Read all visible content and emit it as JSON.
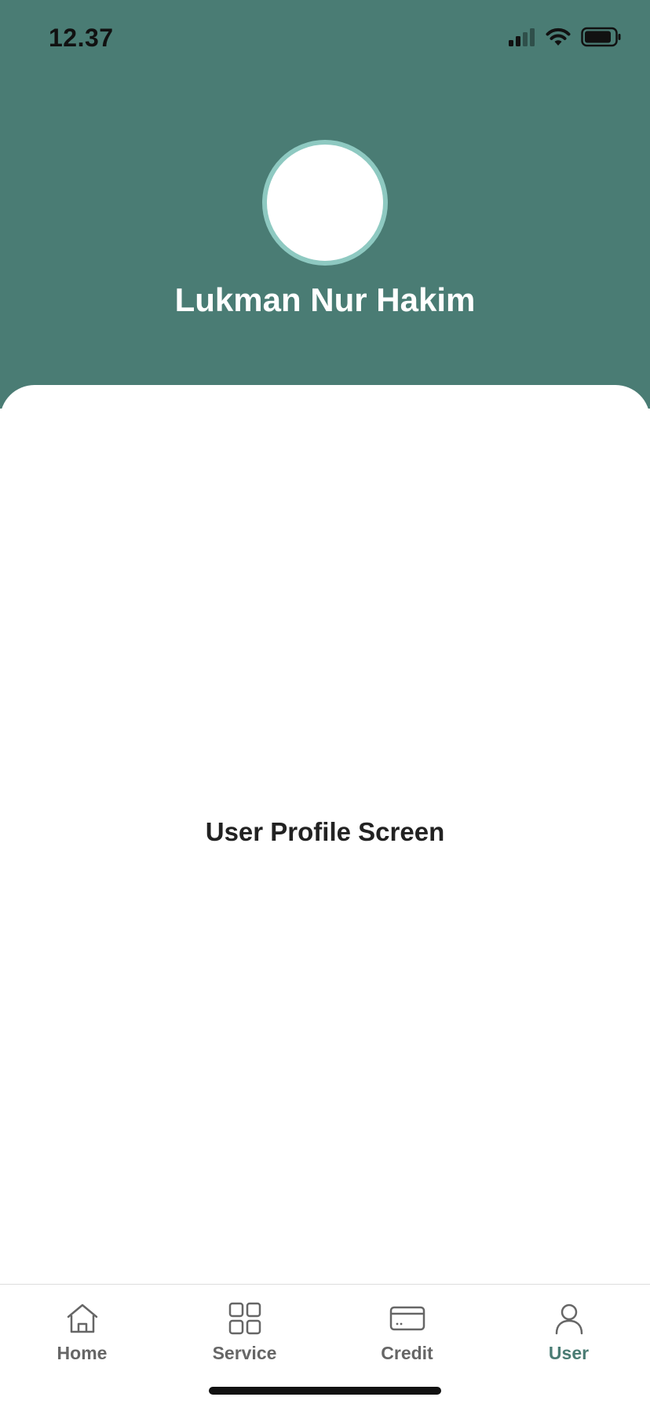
{
  "status_bar": {
    "time": "12.37",
    "signal_icon": "cellular-signal-icon",
    "wifi_icon": "wifi-icon",
    "battery_icon": "battery-icon"
  },
  "header": {
    "user_name": "Lukman Nur Hakim",
    "background_color": "#4a7c74",
    "avatar_border_color": "#8ec9c1"
  },
  "main": {
    "screen_label": "User Profile Screen"
  },
  "tab_bar": {
    "active_color": "#4a7c74",
    "inactive_color": "#666666",
    "tabs": [
      {
        "label": "Home",
        "icon": "home-icon",
        "active": false
      },
      {
        "label": "Service",
        "icon": "grid-icon",
        "active": false
      },
      {
        "label": "Credit",
        "icon": "credit-card-icon",
        "active": false
      },
      {
        "label": "User",
        "icon": "user-icon",
        "active": true
      }
    ]
  }
}
